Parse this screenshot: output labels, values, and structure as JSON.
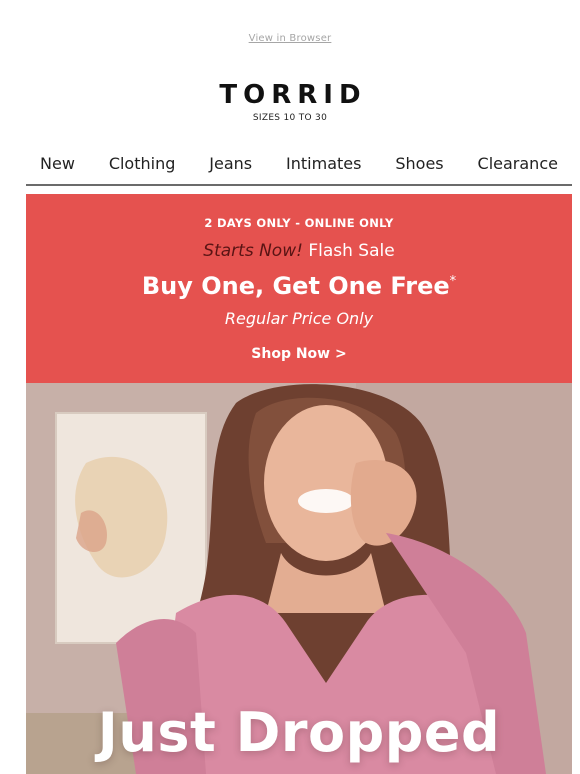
{
  "header": {
    "view_in_browser": "View in Browser",
    "logo": "TORRID",
    "tagline": "SIZES 10 TO 30"
  },
  "nav": {
    "items": [
      {
        "label": "New"
      },
      {
        "label": "Clothing"
      },
      {
        "label": "Jeans"
      },
      {
        "label": "Intimates"
      },
      {
        "label": "Shoes"
      },
      {
        "label": "Clearance"
      }
    ]
  },
  "promo": {
    "eyebrow": "2 DAYS ONLY - ONLINE ONLY",
    "starts": "Starts Now!",
    "flash": "Flash Sale",
    "headline": "Buy One, Get One Free",
    "headline_mark": "*",
    "sub": "Regular Price Only",
    "cta": "Shop Now >"
  },
  "hero": {
    "title": "Just Dropped"
  },
  "colors": {
    "promo_bg": "#e5524f",
    "starts_text": "#5a1414",
    "hero_tint": "#c9b4ad"
  }
}
